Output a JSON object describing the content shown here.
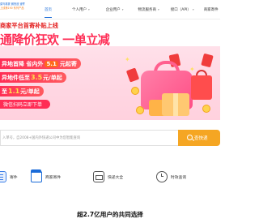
{
  "logo": {
    "line1": "菜鸟裹裹 微快递 速寄",
    "line2": "上线第190 系列产品"
  },
  "nav": {
    "items": [
      {
        "label": "首页",
        "active": true,
        "dropdown": false
      },
      {
        "label": "个人用户",
        "active": false,
        "dropdown": true
      },
      {
        "label": "企业用户",
        "active": false,
        "dropdown": true
      },
      {
        "label": "物流服务商",
        "active": false,
        "dropdown": true
      },
      {
        "label": "接口（API）",
        "active": false,
        "dropdown": true
      },
      {
        "label": "商家寄件",
        "active": false,
        "dropdown": false
      }
    ]
  },
  "banner": {
    "subsidy": "商家平台首寄补贴上线",
    "headline": "通降价狂欢 一单立减",
    "promo1": {
      "pre": "异地首降 省内外",
      "highlight": "5.1",
      "post": "元起寄"
    },
    "promo2": {
      "pre": "异地件低至",
      "highlight": "3.5",
      "post": "元/单起"
    },
    "promo3": {
      "pre": "至",
      "highlight": "1.1",
      "post": "元/单起"
    },
    "cta": "微信扫码立即下单"
  },
  "search": {
    "placeholder": "入单号，自2008+国内外快递公司中为您智能查询",
    "button_label": "查快递"
  },
  "services": [
    {
      "label": "寄件",
      "icon": "document-icon"
    },
    {
      "label": "商家寄件",
      "icon": "store-icon"
    },
    {
      "label": "快递大全",
      "icon": "express-icon"
    },
    {
      "label": "时效查询",
      "icon": "clock-icon"
    }
  ],
  "tagline": "超2.7亿用户的共同选择",
  "colors": {
    "brand_blue": "#1a6bd8",
    "promo_red": "#ff2d55",
    "search_orange": "#f5a623"
  }
}
